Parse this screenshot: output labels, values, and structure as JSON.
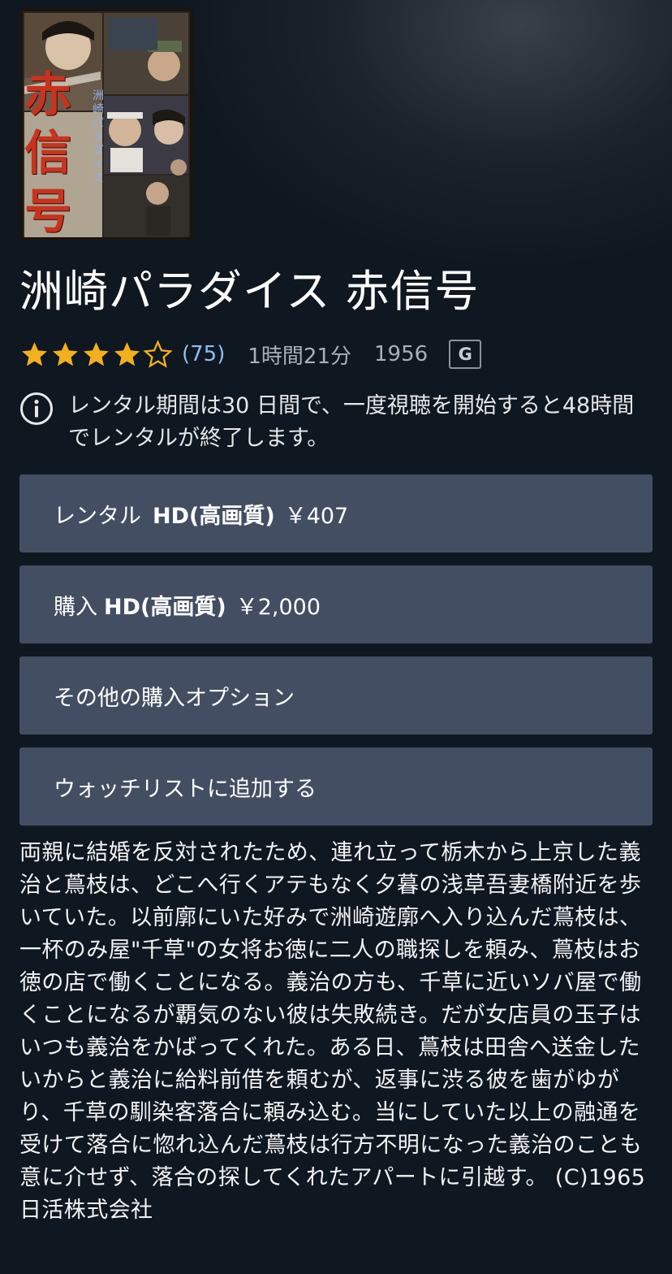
{
  "poster": {
    "title_art": "赤信号",
    "subtitle_art": "洲崎パラダイス"
  },
  "title": "洲崎パラダイス 赤信号",
  "meta": {
    "rating_value": 4.5,
    "rating_max": 5,
    "star_color": "#f2b01e",
    "review_count": "(75)",
    "runtime": "1時間21分",
    "year": "1956",
    "age_rating": "G"
  },
  "notice": {
    "icon": "info-icon",
    "text": "レンタル期間は30 日間で、一度視聴を開始すると48時間でレンタルが終了します。"
  },
  "buttons": {
    "rent": {
      "prefix": "レンタル",
      "quality": "HD(高画質)",
      "price": "￥407"
    },
    "buy": {
      "prefix": "購入",
      "quality": "HD(高画質)",
      "price": "￥2,000"
    },
    "more": {
      "label": "その他の購入オプション"
    },
    "watchlist": {
      "label": "ウォッチリストに追加する"
    }
  },
  "description": "両親に結婚を反対されたため、連れ立って栃木から上京した義治と蔦枝は、どこへ行くアテもなく夕暮の浅草吾妻橋附近を歩いていた。以前廓にいた好みで洲崎遊廓へ入り込んだ蔦枝は、一杯のみ屋\"千草\"の女将お徳に二人の職探しを頼み、蔦枝はお徳の店で働くことになる。義治の方も、千草に近いソバ屋で働くことになるが覇気のない彼は失敗続き。だが女店員の玉子はいつも義治をかばってくれた。ある日、蔦枝は田舎へ送金したいからと義治に給料前借を頼むが、返事に渋る彼を歯がゆがり、千草の馴染客落合に頼み込む。当にしていた以上の融通を受けて落合に惚れ込んだ蔦枝は行方不明になった義治のことも意に介せず、落合の探してくれたアパートに引越す。 (C)1965 日活株式会社"
}
